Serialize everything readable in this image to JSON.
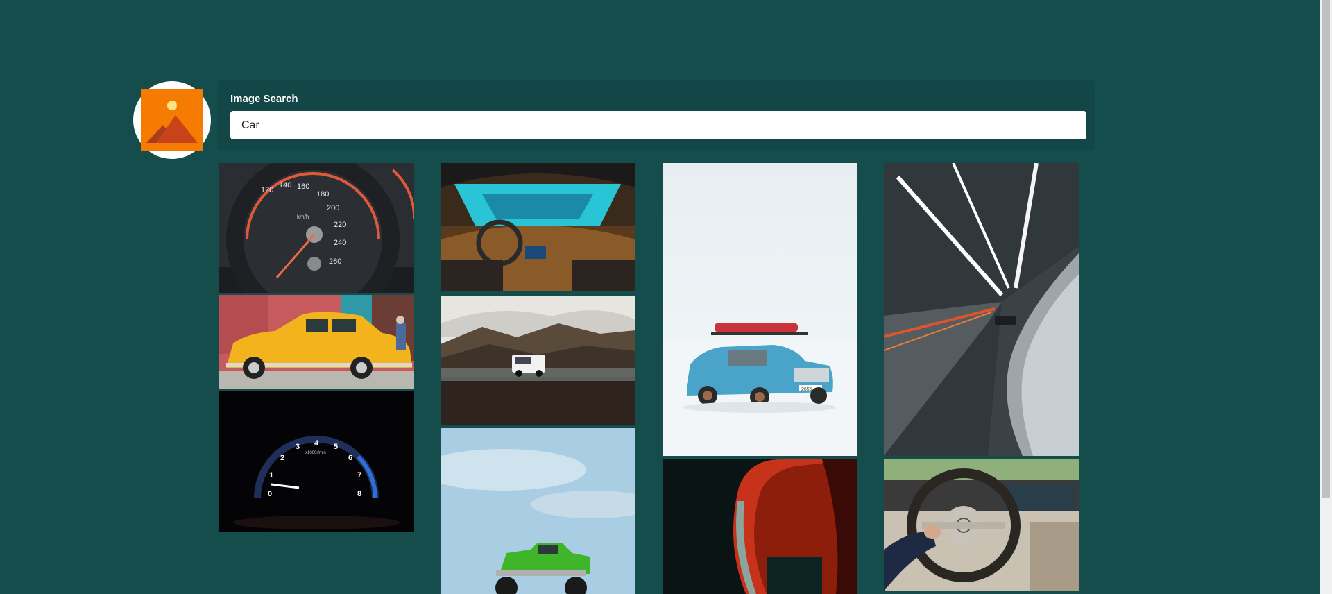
{
  "search": {
    "label": "Image Search",
    "value": "Car"
  },
  "logo": {
    "icon": "image-icon"
  },
  "speedometer": {
    "speed_ticks": [
      "120",
      "140",
      "160",
      "180",
      "200",
      "220",
      "240",
      "260"
    ],
    "unit": "km/h"
  },
  "tachometer": {
    "ticks": [
      "0",
      "1",
      "2",
      "3",
      "4",
      "5",
      "6",
      "7",
      "8"
    ],
    "unit": "x1000r/min"
  },
  "plate": {
    "text": "2655"
  },
  "images": [
    {
      "name": "speedometer"
    },
    {
      "name": "car-interior-lightspeed"
    },
    {
      "name": "blue-car-snow"
    },
    {
      "name": "tunnel-speed"
    },
    {
      "name": "yellow-classic-car"
    },
    {
      "name": "white-suv-mountains"
    },
    {
      "name": "tachometer"
    },
    {
      "name": "green-monster-truck"
    },
    {
      "name": "red-car-detail"
    },
    {
      "name": "steering-wheel"
    }
  ]
}
